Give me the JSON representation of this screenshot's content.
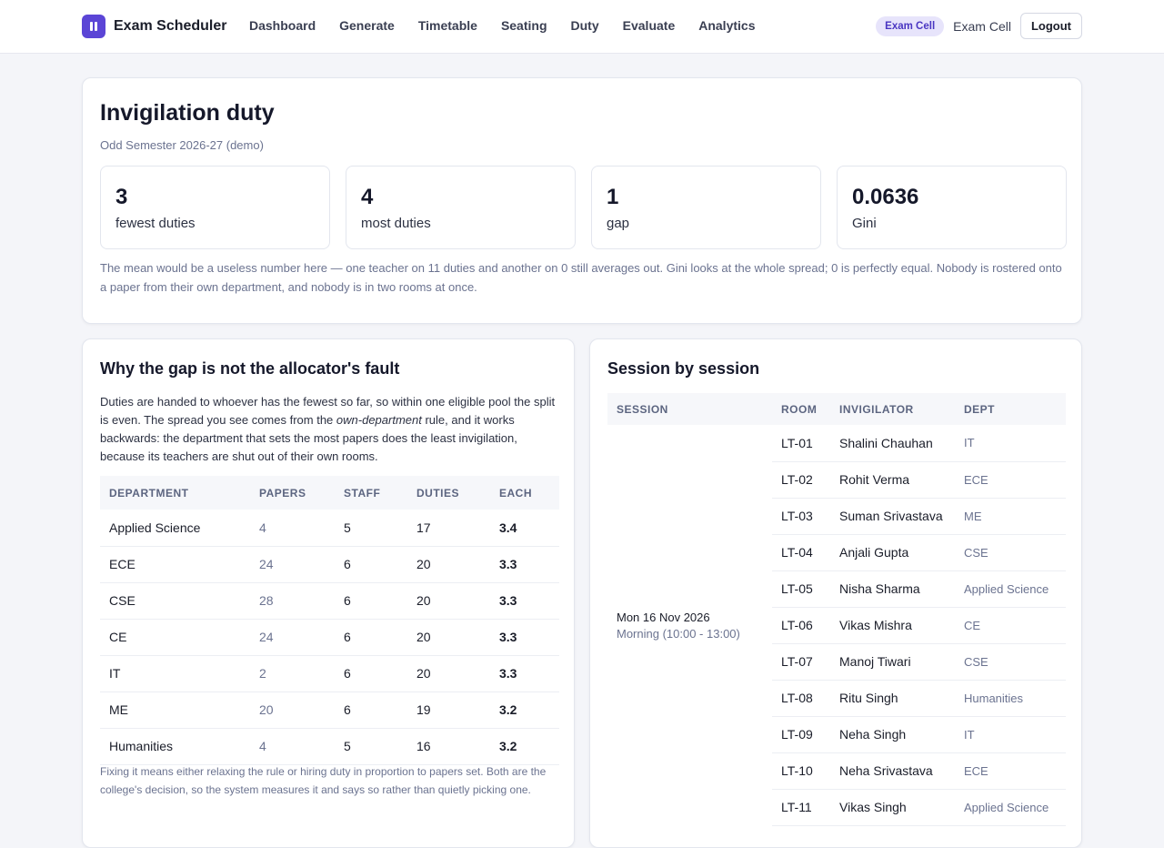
{
  "app": {
    "name": "Exam Scheduler"
  },
  "nav": {
    "links": [
      "Dashboard",
      "Generate",
      "Timetable",
      "Seating",
      "Duty",
      "Evaluate",
      "Analytics"
    ],
    "role_badge": "Exam Cell",
    "user": "Exam Cell",
    "logout": "Logout"
  },
  "summary": {
    "title": "Invigilation duty",
    "subtitle": "Odd Semester 2026-27 (demo)",
    "stats": [
      {
        "value": "3",
        "label": "fewest duties"
      },
      {
        "value": "4",
        "label": "most duties"
      },
      {
        "value": "1",
        "label": "gap"
      },
      {
        "value": "0.0636",
        "label": "Gini"
      }
    ],
    "note": "The mean would be a useless number here — one teacher on 11 duties and another on 0 still averages out. Gini looks at the whole spread; 0 is perfectly equal. Nobody is rostered onto a paper from their own department, and nobody is in two rooms at once."
  },
  "why": {
    "title": "Why the gap is not the allocator's fault",
    "body_1": "Duties are handed to whoever has the fewest so far, so within one eligible pool the split is even. The spread you see comes from the ",
    "body_em": "own-department",
    "body_2": " rule, and it works backwards: the department that sets the most papers does the least invigilation, because its teachers are shut out of their own rooms.",
    "headers": [
      "DEPARTMENT",
      "PAPERS",
      "STAFF",
      "DUTIES",
      "EACH"
    ],
    "rows": [
      {
        "dept": "Applied Science",
        "papers": "4",
        "staff": "5",
        "duties": "17",
        "each": "3.4"
      },
      {
        "dept": "ECE",
        "papers": "24",
        "staff": "6",
        "duties": "20",
        "each": "3.3"
      },
      {
        "dept": "CSE",
        "papers": "28",
        "staff": "6",
        "duties": "20",
        "each": "3.3"
      },
      {
        "dept": "CE",
        "papers": "24",
        "staff": "6",
        "duties": "20",
        "each": "3.3"
      },
      {
        "dept": "IT",
        "papers": "2",
        "staff": "6",
        "duties": "20",
        "each": "3.3"
      },
      {
        "dept": "ME",
        "papers": "20",
        "staff": "6",
        "duties": "19",
        "each": "3.2"
      },
      {
        "dept": "Humanities",
        "papers": "4",
        "staff": "5",
        "duties": "16",
        "each": "3.2"
      }
    ],
    "fix_note": "Fixing it means either relaxing the rule or hiring duty in proportion to papers set. Both are the college's decision, so the system measures it and says so rather than quietly picking one."
  },
  "sessions": {
    "title": "Session by session",
    "headers": [
      "SESSION",
      "ROOM",
      "INVIGILATOR",
      "DEPT"
    ],
    "session_date": "Mon 16 Nov 2026",
    "session_slot": "Morning (10:00 - 13:00)",
    "rows": [
      {
        "room": "LT-01",
        "name": "Shalini Chauhan",
        "dept": "IT"
      },
      {
        "room": "LT-02",
        "name": "Rohit Verma",
        "dept": "ECE"
      },
      {
        "room": "LT-03",
        "name": "Suman Srivastava",
        "dept": "ME"
      },
      {
        "room": "LT-04",
        "name": "Anjali Gupta",
        "dept": "CSE"
      },
      {
        "room": "LT-05",
        "name": "Nisha Sharma",
        "dept": "Applied Science"
      },
      {
        "room": "LT-06",
        "name": "Vikas Mishra",
        "dept": "CE"
      },
      {
        "room": "LT-07",
        "name": "Manoj Tiwari",
        "dept": "CSE"
      },
      {
        "room": "LT-08",
        "name": "Ritu Singh",
        "dept": "Humanities"
      },
      {
        "room": "LT-09",
        "name": "Neha Singh",
        "dept": "IT"
      },
      {
        "room": "LT-10",
        "name": "Neha Srivastava",
        "dept": "ECE"
      },
      {
        "room": "LT-11",
        "name": "Vikas Singh",
        "dept": "Applied Science"
      }
    ]
  }
}
